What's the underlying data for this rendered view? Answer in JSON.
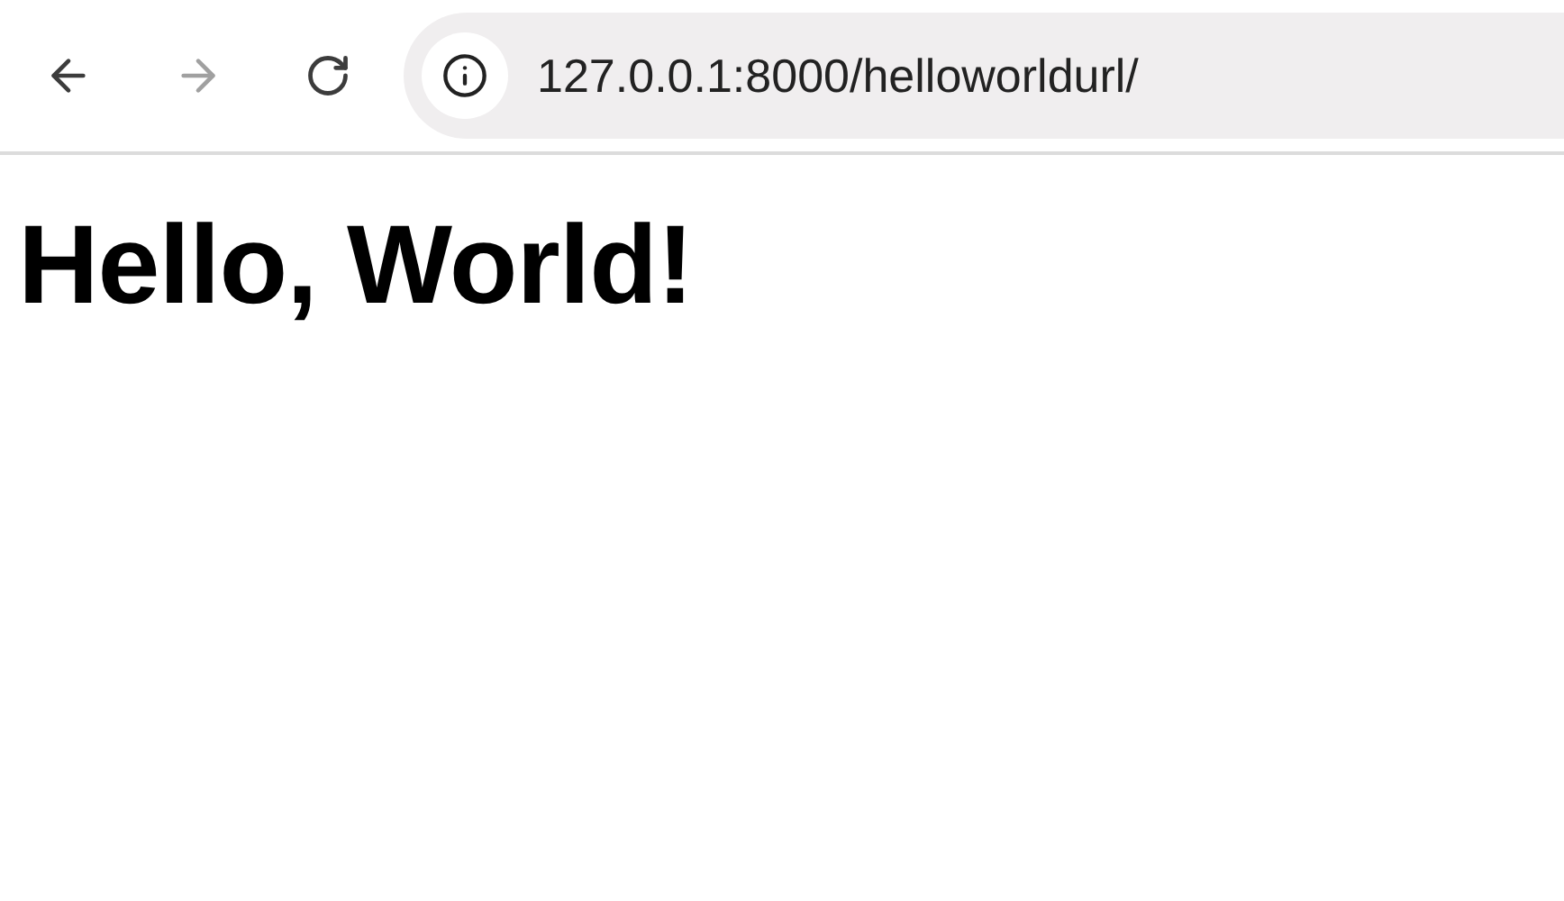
{
  "toolbar": {
    "back": {
      "disabled": false
    },
    "forward": {
      "disabled": true
    },
    "address": {
      "value": "127.0.0.1:8000/helloworldurl/"
    }
  },
  "page": {
    "heading": "Hello, World!"
  }
}
